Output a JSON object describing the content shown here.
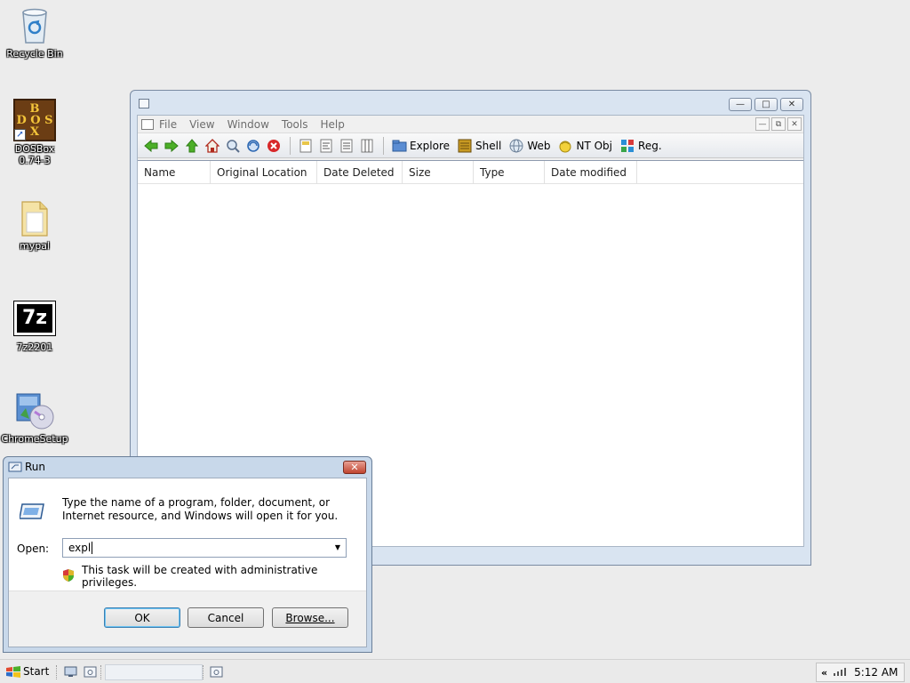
{
  "desktop": {
    "icons": [
      {
        "label": "Recycle Bin"
      },
      {
        "label": "DOSBox\n0.74-3"
      },
      {
        "label": "mypal"
      },
      {
        "label": "7z2201"
      },
      {
        "label": "ChromeSetup"
      }
    ],
    "dosbox_logo": "BDOSX"
  },
  "explorer": {
    "menu": [
      "File",
      "View",
      "Window",
      "Tools",
      "Help"
    ],
    "toolbar_buttons": [
      "Explore",
      "Shell",
      "Web",
      "NT Obj",
      "Reg."
    ],
    "columns": [
      "Name",
      "Original Location",
      "Date Deleted",
      "Size",
      "Type",
      "Date modified"
    ],
    "minimize_icon": "minimize-icon",
    "maximize_icon": "maximize-icon",
    "close_icon": "close-icon"
  },
  "run_dialog": {
    "title": "Run",
    "description": "Type the name of a program, folder, document, or Internet resource, and Windows will open it for you.",
    "open_label": "Open:",
    "open_value": "expl",
    "admin_note": "This task will be created with administrative privileges.",
    "ok": "OK",
    "cancel": "Cancel",
    "browse": "Browse..."
  },
  "taskbar": {
    "start_label": "Start",
    "clock": "5:12 AM",
    "tray_chevron": "«"
  },
  "colors": {
    "accent": "#3c7fb1",
    "close_red": "#c0442f",
    "window_frame": "#d9e4f1"
  }
}
